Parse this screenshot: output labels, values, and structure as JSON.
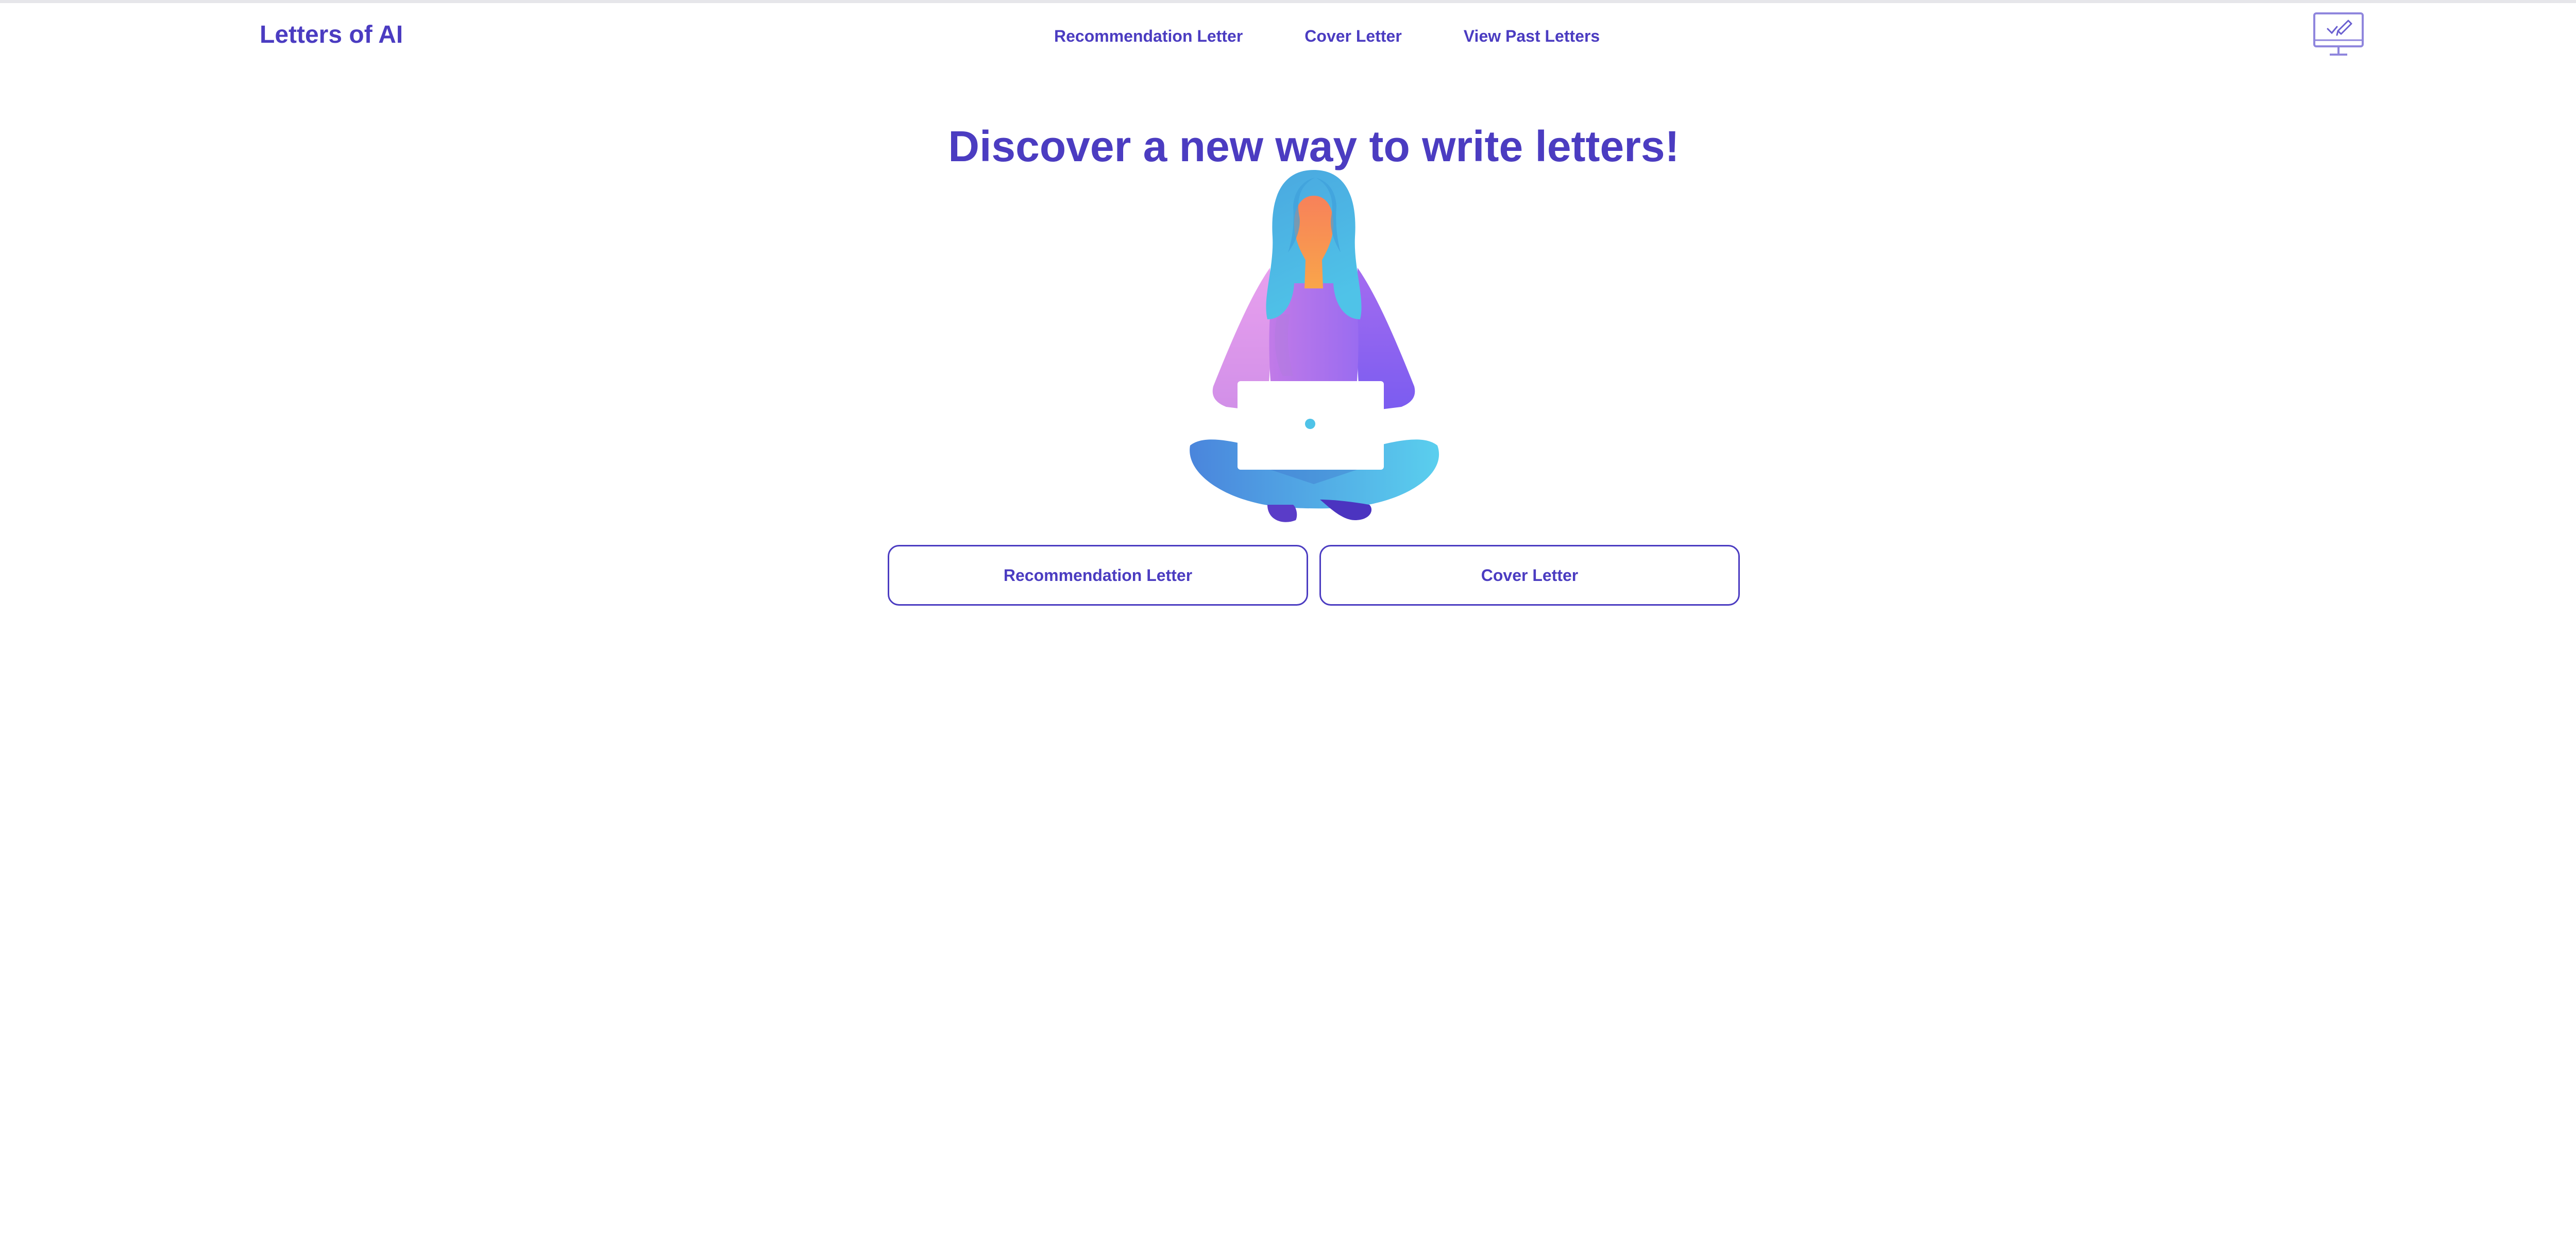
{
  "header": {
    "brand": "Letters of AI",
    "nav": [
      {
        "label": "Recommendation Letter"
      },
      {
        "label": "Cover Letter"
      },
      {
        "label": "View Past Letters"
      }
    ],
    "logo_icon": "monitor-pen-icon"
  },
  "hero": {
    "title": "Discover a new way to write letters!",
    "illustration": "woman-with-laptop-illustration"
  },
  "actions": {
    "recommendation_label": "Recommendation Letter",
    "cover_label": "Cover Letter"
  },
  "colors": {
    "accent": "#4b3cc1",
    "background": "#ffffff"
  }
}
